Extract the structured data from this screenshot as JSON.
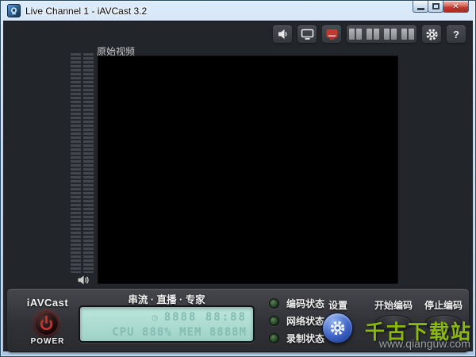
{
  "window": {
    "title": "Live Channel 1 - iAVCast 3.2",
    "close_glyph": "✕"
  },
  "toolbar": {
    "help_label": "?"
  },
  "video": {
    "label": "原始视频"
  },
  "panel": {
    "brand": "iAVCast",
    "power": "POWER",
    "slogan": "串流 · 直播 · 专家",
    "lcd": {
      "clock_icon": "◷",
      "time": "8888 88:88",
      "stats": "CPU 888% MEM 8888M"
    },
    "status": [
      {
        "label": "编码状态"
      },
      {
        "label": "网络状态"
      },
      {
        "label": "录制状态"
      }
    ],
    "settings": "设置",
    "start": "开始编码",
    "stop": "停止编码"
  },
  "watermark": {
    "name": "千古下载站",
    "url": "www.qianguw.com"
  },
  "colors": {
    "lcd_bg": "#a9dcd0",
    "lcd_text": "#84bcb1",
    "led_green": "#2f5a33",
    "settings_blue": "#3c63c4",
    "power_red": "#cc3333",
    "watermark_green": "#8bb80e",
    "close_red": "#c23b2e"
  }
}
